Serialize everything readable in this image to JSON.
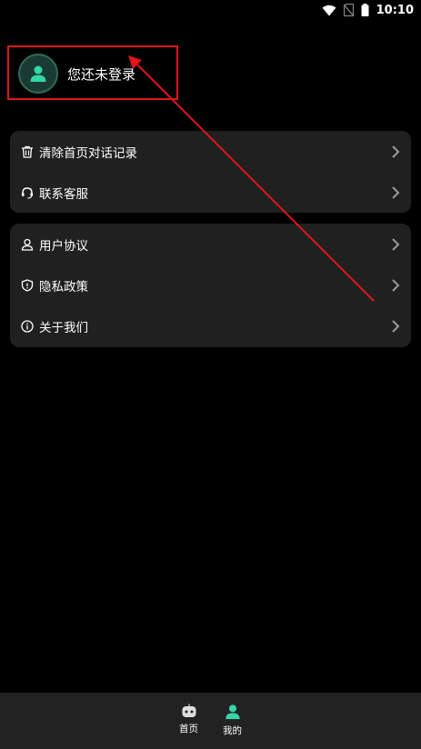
{
  "status_bar": {
    "time": "10:10"
  },
  "profile": {
    "name": "您还未登录"
  },
  "menu_group_1": [
    {
      "label": "清除首页对话记录",
      "icon": "trash-icon"
    },
    {
      "label": "联系客服",
      "icon": "headset-icon"
    }
  ],
  "menu_group_2": [
    {
      "label": "用户协议",
      "icon": "user-agreement-icon"
    },
    {
      "label": "隐私政策",
      "icon": "shield-icon"
    },
    {
      "label": "关于我们",
      "icon": "info-icon"
    }
  ],
  "tabs": [
    {
      "label": "首页",
      "icon": "robot-icon"
    },
    {
      "label": "我的",
      "icon": "user-icon",
      "active": true
    }
  ],
  "colors": {
    "accent": "#35d6a3",
    "annotation": "#e0161b",
    "card": "#202020",
    "tabbar": "#222222"
  }
}
